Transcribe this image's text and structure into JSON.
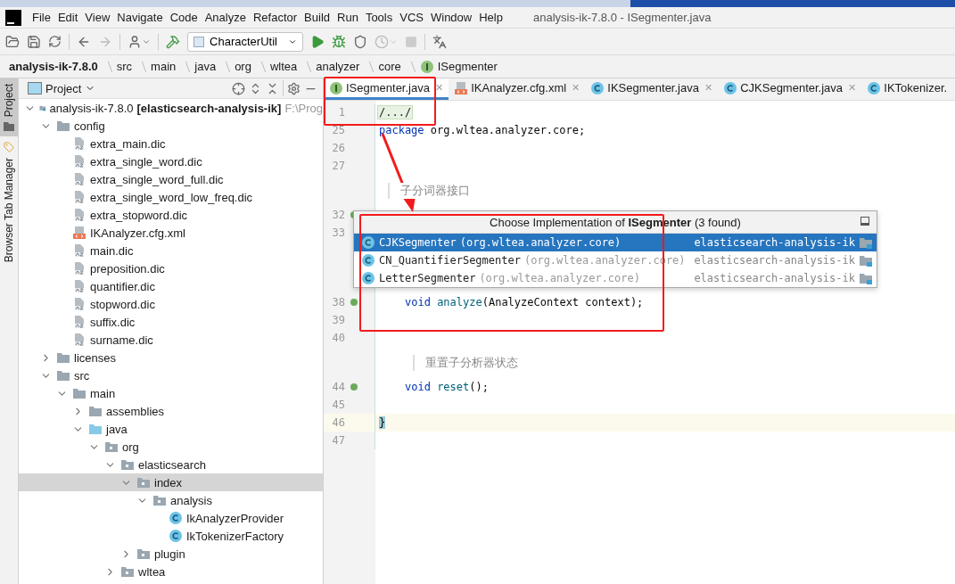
{
  "window": {
    "title": "analysis-ik-7.8.0 - ISegmenter.java"
  },
  "menu": [
    "File",
    "Edit",
    "View",
    "Navigate",
    "Code",
    "Analyze",
    "Refactor",
    "Build",
    "Run",
    "Tools",
    "VCS",
    "Window",
    "Help"
  ],
  "toolbar": {
    "run_config": "CharacterUtil"
  },
  "breadcrumb": [
    {
      "label": "analysis-ik-7.8.0",
      "kind": "project"
    },
    {
      "label": "src",
      "kind": "folder"
    },
    {
      "label": "main",
      "kind": "folder"
    },
    {
      "label": "java",
      "kind": "folder"
    },
    {
      "label": "org",
      "kind": "folder"
    },
    {
      "label": "wltea",
      "kind": "folder"
    },
    {
      "label": "analyzer",
      "kind": "folder"
    },
    {
      "label": "core",
      "kind": "folder"
    },
    {
      "label": "ISegmenter",
      "kind": "interface"
    }
  ],
  "side_tabs": [
    {
      "label": "Project",
      "selected": true
    },
    {
      "label": "Browser Tab Manager",
      "selected": false
    }
  ],
  "project_panel": {
    "title": "Project",
    "tree": [
      {
        "label": "analysis-ik-7.8.0",
        "module": "[elasticsearch-analysis-ik]",
        "path": "F:\\Prog",
        "kind": "module",
        "expanded": true,
        "selected": false,
        "children": [
          {
            "label": "config",
            "kind": "folder",
            "expanded": true,
            "selected": false,
            "children": [
              {
                "label": "extra_main.dic",
                "kind": "dic",
                "selected": false
              },
              {
                "label": "extra_single_word.dic",
                "kind": "dic",
                "selected": false
              },
              {
                "label": "extra_single_word_full.dic",
                "kind": "dic",
                "selected": false
              },
              {
                "label": "extra_single_word_low_freq.dic",
                "kind": "dic",
                "selected": false
              },
              {
                "label": "extra_stopword.dic",
                "kind": "dic",
                "selected": false
              },
              {
                "label": "IKAnalyzer.cfg.xml",
                "kind": "xml",
                "selected": false
              },
              {
                "label": "main.dic",
                "kind": "dic",
                "selected": false
              },
              {
                "label": "preposition.dic",
                "kind": "dic",
                "selected": false
              },
              {
                "label": "quantifier.dic",
                "kind": "dic",
                "selected": false
              },
              {
                "label": "stopword.dic",
                "kind": "dic",
                "selected": false
              },
              {
                "label": "suffix.dic",
                "kind": "dic",
                "selected": false
              },
              {
                "label": "surname.dic",
                "kind": "dic",
                "selected": false
              }
            ]
          },
          {
            "label": "licenses",
            "kind": "folder",
            "expanded": false,
            "selected": false
          },
          {
            "label": "src",
            "kind": "folder",
            "expanded": true,
            "selected": false,
            "children": [
              {
                "label": "main",
                "kind": "folder",
                "expanded": true,
                "selected": false,
                "children": [
                  {
                    "label": "assemblies",
                    "kind": "folder",
                    "expanded": false,
                    "selected": false
                  },
                  {
                    "label": "java",
                    "kind": "source",
                    "expanded": true,
                    "selected": false,
                    "children": [
                      {
                        "label": "org",
                        "kind": "package",
                        "expanded": true,
                        "selected": false,
                        "children": [
                          {
                            "label": "elasticsearch",
                            "kind": "package",
                            "expanded": true,
                            "selected": false,
                            "children": [
                              {
                                "label": "index",
                                "kind": "package",
                                "expanded": true,
                                "selected": true,
                                "children": [
                                  {
                                    "label": "analysis",
                                    "kind": "package",
                                    "expanded": true,
                                    "selected": false,
                                    "children": [
                                      {
                                        "label": "IkAnalyzerProvider",
                                        "kind": "class",
                                        "selected": false
                                      },
                                      {
                                        "label": "IkTokenizerFactory",
                                        "kind": "class",
                                        "selected": false
                                      }
                                    ]
                                  }
                                ]
                              },
                              {
                                "label": "plugin",
                                "kind": "package",
                                "expanded": false,
                                "selected": false
                              }
                            ]
                          },
                          {
                            "label": "wltea",
                            "kind": "package",
                            "expanded": false,
                            "selected": false
                          }
                        ]
                      }
                    ]
                  }
                ]
              }
            ]
          }
        ]
      }
    ]
  },
  "editor": {
    "tabs": [
      {
        "label": "ISegmenter.java",
        "kind": "interface",
        "selected": true,
        "close": "✕"
      },
      {
        "label": "IKAnalyzer.cfg.xml",
        "kind": "xml",
        "selected": false,
        "close": "✕"
      },
      {
        "label": "IKSegmenter.java",
        "kind": "class",
        "selected": false,
        "close": "✕"
      },
      {
        "label": "CJKSegmenter.java",
        "kind": "class",
        "selected": false,
        "close": "✕"
      },
      {
        "label": "IKTokenizer.",
        "kind": "class",
        "selected": false
      }
    ],
    "lines": [
      {
        "kind": "fold",
        "number": "1",
        "text": "/.../",
        "implemented": false,
        "current": false
      },
      {
        "kind": "code",
        "number": "25",
        "parts": [
          {
            "text": "package",
            "kind": "keyword"
          },
          {
            "text": "org.wltea.analyzer.core;",
            "kind": "plain"
          }
        ],
        "implemented": false,
        "current": false
      },
      {
        "kind": "code",
        "number": "26",
        "implemented": false,
        "current": false
      },
      {
        "kind": "code",
        "number": "27",
        "implemented": false,
        "current": false
      },
      {
        "kind": "doc",
        "text": "子分词器接口"
      },
      {
        "kind": "code",
        "number": "32",
        "implemented": true,
        "current": false
      },
      {
        "kind": "code",
        "number": "33",
        "implemented": false,
        "current": false
      },
      {
        "kind": "gap"
      },
      {
        "kind": "member",
        "number": "38",
        "parts": [
          {
            "text": "void",
            "kind": "keyword"
          },
          {
            "text": "analyze",
            "kind": "method"
          },
          {
            "text": "(AnalyzeContext context);",
            "kind": "plain"
          }
        ],
        "implemented": true,
        "current": false
      },
      {
        "kind": "code",
        "number": "39",
        "implemented": false,
        "current": false
      },
      {
        "kind": "code",
        "number": "40",
        "implemented": false,
        "current": false
      },
      {
        "kind": "member_doc",
        "text": "重置子分析器状态"
      },
      {
        "kind": "member",
        "number": "44",
        "parts": [
          {
            "text": "void",
            "kind": "keyword"
          },
          {
            "text": "reset",
            "kind": "method"
          },
          {
            "text": "();",
            "kind": "plain"
          }
        ],
        "implemented": true,
        "current": false
      },
      {
        "kind": "code",
        "number": "45",
        "implemented": false,
        "current": false
      },
      {
        "kind": "code",
        "number": "46",
        "parts": [
          {
            "text": "}",
            "kind": "brace"
          }
        ],
        "implemented": false,
        "current": true
      },
      {
        "kind": "code",
        "number": "47",
        "implemented": false,
        "current": false
      }
    ]
  },
  "popup": {
    "title": "Choose Implementation of **ISegmenter** (3 found)",
    "items": [
      {
        "name": "CJKSegmenter",
        "package": "(org.wltea.analyzer.core)",
        "module": "elasticsearch-analysis-ik",
        "selected": true
      },
      {
        "name": "CN_QuantifierSegmenter",
        "package": "(org.wltea.analyzer.core)",
        "module": "elasticsearch-analysis-ik",
        "selected": false
      },
      {
        "name": "LetterSegmenter",
        "package": "(org.wltea.analyzer.core)",
        "module": "elasticsearch-analysis-ik",
        "selected": false
      }
    ]
  }
}
